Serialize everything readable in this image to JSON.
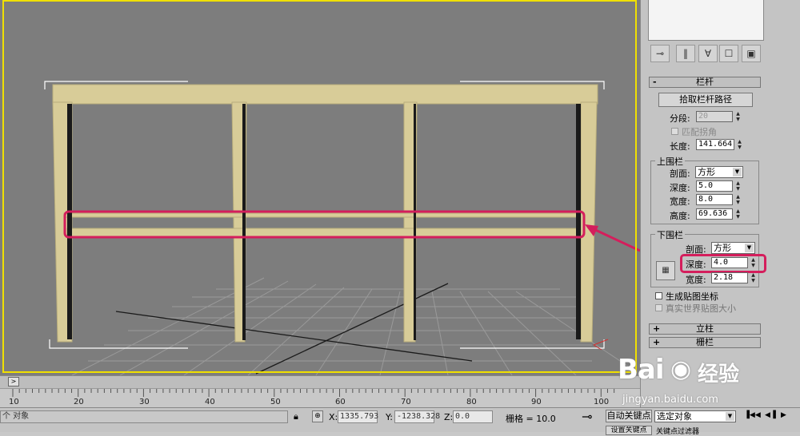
{
  "viewport": {
    "accent_color": "#f0e000",
    "rail_color": "#d8cc98",
    "highlight_color": "#d41e5c"
  },
  "panel": {
    "toolbar_icons": [
      "pin-icon",
      "separator-icon",
      "fork-icon",
      "lock-icon",
      "configure-icon"
    ],
    "railing_rollout": {
      "title": "栏杆",
      "sign": "-",
      "pick_path_button": "拾取栏杆路径",
      "segments_label": "分段:",
      "segments_value": "20",
      "match_corners_label": "匹配拐角",
      "length_label": "长度:",
      "length_value": "141.664"
    },
    "top_rail": {
      "group_title": "上围栏",
      "profile_label": "剖面:",
      "profile_value": "方形",
      "depth_label": "深度:",
      "depth_value": "5.0",
      "width_label": "宽度:",
      "width_value": "8.0",
      "height_label": "高度:",
      "height_value": "69.636"
    },
    "lower_rail": {
      "group_title": "下围栏",
      "profile_label": "剖面:",
      "profile_value": "方形",
      "depth_label": "深度:",
      "depth_value": "4.0",
      "width_label": "宽度:",
      "width_value": "2.18"
    },
    "gen_mapping_label": "生成贴图坐标",
    "real_world_label": "真实世界贴图大小",
    "posts_rollout": {
      "title": "立柱",
      "sign": "+"
    },
    "fencing_rollout": {
      "title": "栅栏",
      "sign": "+"
    }
  },
  "timeline": {
    "ticks": [
      "10",
      "20",
      "30",
      "40",
      "50",
      "60",
      "70",
      "80",
      "90",
      "100"
    ]
  },
  "statusbar": {
    "selection_text": "个 对象",
    "x_label": "X:",
    "x_value": "1335.793",
    "y_label": "Y:",
    "y_value": "-1238.328",
    "z_label": "Z:",
    "z_value": "0.0",
    "grid_text": "栅格 = 10.0",
    "auto_key_label": "自动关键点",
    "selection_mode": "选定对象",
    "set_key_label": "设置关键点",
    "key_filters_label": "关键点过滤器"
  },
  "watermark": {
    "logo": "Bai",
    "logo_cn": "经验",
    "url": "jingyan.baidu.com"
  }
}
